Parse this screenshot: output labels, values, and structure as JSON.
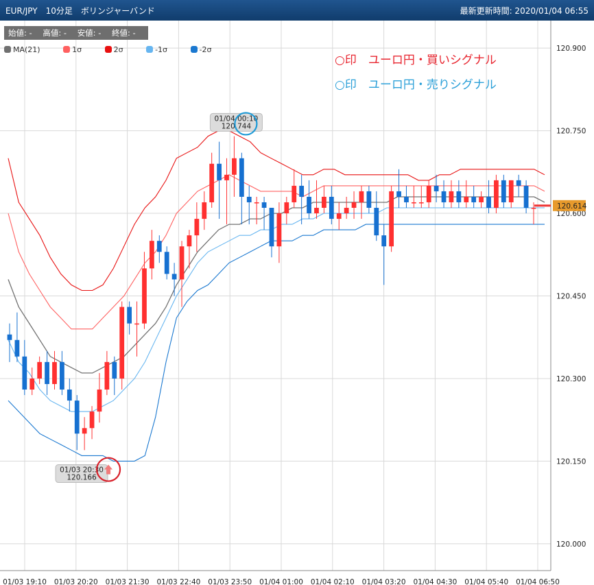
{
  "header": {
    "title": "EUR/JPY　10分足　ボリンジャーバンド",
    "updated": "最新更新時間: 2020/01/04 06:55"
  },
  "ohlc": {
    "open": "始値: -",
    "high": "高値: -",
    "low": "安値: -",
    "close": "終値: -"
  },
  "legend": [
    {
      "label": "MA(21)",
      "color": "#707070"
    },
    {
      "label": "1σ",
      "color": "#ff6060"
    },
    {
      "label": "2σ",
      "color": "#e81010"
    },
    {
      "label": "-1σ",
      "color": "#66b5f0"
    },
    {
      "label": "-2σ",
      "color": "#1a78d0"
    }
  ],
  "annotations": {
    "buy": "○印　ユーロ円・買いシグナル",
    "sell": "○印　ユーロ円・売りシグナル",
    "buy_color": "#e8252f",
    "sell_color": "#2a9fd8"
  },
  "chart_data": {
    "type": "candlestick",
    "ylim": [
      119.95,
      120.95
    ],
    "y_ticks": [
      "120.900",
      "120.750",
      "120.600",
      "120.450",
      "120.300",
      "120.150",
      "120.000"
    ],
    "x_ticks": [
      "01/03 19:10",
      "01/03 20:20",
      "01/03 21:30",
      "01/03 22:40",
      "01/03 23:50",
      "01/04 01:00",
      "01/04 02:10",
      "01/04 03:20",
      "01/04 04:30",
      "01/04 05:40",
      "01/04 06:50"
    ],
    "last_price": "120.614",
    "up_color": "#ff3030",
    "down_color": "#1670d0",
    "candles": [
      [
        120.38,
        120.37,
        120.4,
        120.33
      ],
      [
        120.37,
        120.34,
        120.42,
        120.33
      ],
      [
        120.34,
        120.28,
        120.37,
        120.27
      ],
      [
        120.28,
        120.3,
        120.32,
        120.27
      ],
      [
        120.3,
        120.33,
        120.34,
        120.29
      ],
      [
        120.33,
        120.29,
        120.35,
        120.27
      ],
      [
        120.29,
        120.33,
        120.35,
        120.28
      ],
      [
        120.33,
        120.28,
        120.35,
        120.27
      ],
      [
        120.28,
        120.26,
        120.3,
        120.24
      ],
      [
        120.26,
        120.2,
        120.27,
        120.17
      ],
      [
        120.2,
        120.21,
        120.23,
        120.17
      ],
      [
        120.21,
        120.24,
        120.25,
        120.19
      ],
      [
        120.24,
        120.28,
        120.31,
        120.22
      ],
      [
        120.28,
        120.33,
        120.35,
        120.27
      ],
      [
        120.33,
        120.3,
        120.34,
        120.27
      ],
      [
        120.3,
        120.43,
        120.44,
        120.28
      ],
      [
        120.43,
        120.4,
        120.44,
        120.38
      ],
      [
        120.4,
        120.4,
        120.44,
        120.34
      ],
      [
        120.4,
        120.5,
        120.53,
        120.39
      ],
      [
        120.5,
        120.55,
        120.57,
        120.48
      ],
      [
        120.55,
        120.53,
        120.56,
        120.51
      ],
      [
        120.53,
        120.49,
        120.54,
        120.48
      ],
      [
        120.49,
        120.48,
        120.51,
        120.45
      ],
      [
        120.48,
        120.54,
        120.55,
        120.43
      ],
      [
        120.54,
        120.56,
        120.57,
        120.5
      ],
      [
        120.56,
        120.59,
        120.62,
        120.53
      ],
      [
        120.59,
        120.62,
        120.64,
        120.57
      ],
      [
        120.62,
        120.69,
        120.71,
        120.61
      ],
      [
        120.69,
        120.66,
        120.73,
        120.59
      ],
      [
        120.66,
        120.67,
        120.7,
        120.58
      ],
      [
        120.67,
        120.7,
        120.74,
        120.63
      ],
      [
        120.7,
        120.63,
        120.71,
        120.58
      ],
      [
        120.63,
        120.62,
        120.65,
        120.58
      ],
      [
        120.62,
        120.62,
        120.63,
        120.58
      ],
      [
        120.62,
        120.61,
        120.63,
        120.57
      ],
      [
        120.61,
        120.54,
        120.61,
        120.52
      ],
      [
        120.54,
        120.6,
        120.62,
        120.51
      ],
      [
        120.6,
        120.62,
        120.63,
        120.58
      ],
      [
        120.62,
        120.65,
        120.68,
        120.61
      ],
      [
        120.65,
        120.63,
        120.67,
        120.58
      ],
      [
        120.63,
        120.6,
        120.66,
        120.59
      ],
      [
        120.6,
        120.61,
        120.66,
        120.59
      ],
      [
        120.61,
        120.63,
        120.65,
        120.6
      ],
      [
        120.63,
        120.59,
        120.65,
        120.58
      ],
      [
        120.59,
        120.6,
        120.62,
        120.57
      ],
      [
        120.6,
        120.61,
        120.63,
        120.59
      ],
      [
        120.61,
        120.62,
        120.64,
        120.59
      ],
      [
        120.62,
        120.64,
        120.65,
        120.59
      ],
      [
        120.64,
        120.61,
        120.65,
        120.6
      ],
      [
        120.61,
        120.56,
        120.64,
        120.55
      ],
      [
        120.56,
        120.54,
        120.58,
        120.47
      ],
      [
        120.54,
        120.64,
        120.65,
        120.53
      ],
      [
        120.64,
        120.63,
        120.68,
        120.61
      ],
      [
        120.63,
        120.62,
        120.65,
        120.61
      ],
      [
        120.62,
        120.62,
        120.65,
        120.61
      ],
      [
        120.62,
        120.62,
        120.65,
        120.61
      ],
      [
        120.62,
        120.65,
        120.66,
        120.61
      ],
      [
        120.65,
        120.64,
        120.67,
        120.62
      ],
      [
        120.64,
        120.62,
        120.66,
        120.61
      ],
      [
        120.62,
        120.64,
        120.66,
        120.61
      ],
      [
        120.64,
        120.62,
        120.66,
        120.61
      ],
      [
        120.62,
        120.63,
        120.66,
        120.61
      ],
      [
        120.63,
        120.62,
        120.65,
        120.61
      ],
      [
        120.62,
        120.63,
        120.64,
        120.61
      ],
      [
        120.63,
        120.61,
        120.66,
        120.6
      ],
      [
        120.61,
        120.66,
        120.67,
        120.6
      ],
      [
        120.66,
        120.62,
        120.67,
        120.61
      ],
      [
        120.62,
        120.66,
        120.66,
        120.61
      ],
      [
        120.66,
        120.65,
        120.67,
        120.63
      ],
      [
        120.65,
        120.61,
        120.66,
        120.6
      ],
      [
        120.61,
        120.61,
        120.62,
        120.58
      ]
    ],
    "bands": {
      "plus2": [
        120.7,
        120.62,
        120.59,
        120.56,
        120.52,
        120.49,
        120.47,
        120.46,
        120.46,
        120.47,
        120.5,
        120.54,
        120.58,
        120.61,
        120.63,
        120.66,
        120.7,
        120.71,
        120.72,
        120.74,
        120.75,
        120.75,
        120.74,
        120.73,
        120.71,
        120.7,
        120.69,
        120.68,
        120.67,
        120.67,
        120.68,
        120.68,
        120.67,
        120.67,
        120.67,
        120.67,
        120.67,
        120.67,
        120.67,
        120.66,
        120.66,
        120.67,
        120.67,
        120.68,
        120.68,
        120.68,
        120.68,
        120.68,
        120.68,
        120.68,
        120.68,
        120.67
      ],
      "plus1": [
        120.6,
        120.53,
        120.49,
        120.46,
        120.43,
        120.41,
        120.39,
        120.39,
        120.39,
        120.41,
        120.43,
        120.45,
        120.48,
        120.51,
        120.53,
        120.56,
        120.6,
        120.62,
        120.64,
        120.65,
        120.66,
        120.67,
        120.66,
        120.65,
        120.64,
        120.64,
        120.64,
        120.64,
        120.63,
        120.64,
        120.65,
        120.65,
        120.65,
        120.65,
        120.65,
        120.65,
        120.65,
        120.65,
        120.65,
        120.65,
        120.65,
        120.65,
        120.65,
        120.65,
        120.65,
        120.65,
        120.65,
        120.65,
        120.65,
        120.65,
        120.65,
        120.64
      ],
      "ma": [
        120.48,
        120.43,
        120.4,
        120.37,
        120.34,
        120.33,
        120.32,
        120.31,
        120.31,
        120.32,
        120.33,
        120.34,
        120.36,
        120.38,
        120.4,
        120.43,
        120.47,
        120.5,
        120.53,
        120.55,
        120.57,
        120.58,
        120.58,
        120.59,
        120.59,
        120.6,
        120.6,
        120.61,
        120.61,
        120.62,
        120.62,
        120.62,
        120.62,
        120.62,
        120.62,
        120.62,
        120.62,
        120.63,
        120.63,
        120.63,
        120.63,
        120.63,
        120.63,
        120.63,
        120.63,
        120.63,
        120.63,
        120.63,
        120.63,
        120.63,
        120.63,
        120.62
      ],
      "minus1": [
        120.37,
        120.33,
        120.31,
        120.28,
        120.26,
        120.25,
        120.24,
        120.24,
        120.24,
        120.25,
        120.26,
        120.28,
        120.3,
        120.33,
        120.37,
        120.41,
        120.45,
        120.48,
        120.51,
        120.53,
        120.54,
        120.55,
        120.56,
        120.56,
        120.57,
        120.57,
        120.58,
        120.58,
        120.59,
        120.59,
        120.6,
        120.6,
        120.6,
        120.6,
        120.6,
        120.6,
        120.61,
        120.61,
        120.61,
        120.61,
        120.61,
        120.61,
        120.61,
        120.61,
        120.61,
        120.61,
        120.61,
        120.61,
        120.61,
        120.61,
        120.61,
        120.61
      ],
      "minus2": [
        120.26,
        120.24,
        120.22,
        120.2,
        120.19,
        120.18,
        120.17,
        120.16,
        120.16,
        120.16,
        120.15,
        120.15,
        120.15,
        120.16,
        120.23,
        120.33,
        120.41,
        120.44,
        120.46,
        120.47,
        120.49,
        120.51,
        120.52,
        120.53,
        120.54,
        120.55,
        120.55,
        120.55,
        120.56,
        120.56,
        120.57,
        120.57,
        120.57,
        120.57,
        120.58,
        120.58,
        120.58,
        120.58,
        120.58,
        120.58,
        120.58,
        120.58,
        120.58,
        120.58,
        120.58,
        120.58,
        120.58,
        120.58,
        120.58,
        120.58,
        120.58,
        120.58
      ]
    },
    "callouts": [
      {
        "time": "01/04 00:10",
        "price": "120.744",
        "value": 120.744,
        "index": 30,
        "circle_color": "#1e9ad6",
        "position": "above"
      },
      {
        "time": "01/03 20:30",
        "price": "120.166",
        "value": 120.166,
        "index": 11,
        "circle_color": "#d8202a",
        "position": "below"
      }
    ]
  }
}
